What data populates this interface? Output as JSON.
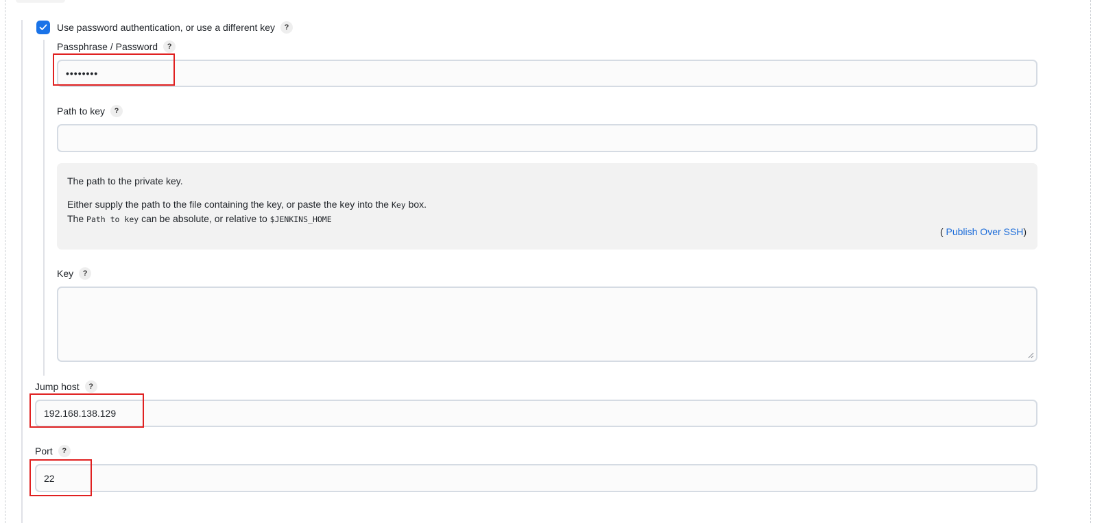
{
  "use_password_auth": {
    "label": "Use password authentication, or use a different key",
    "checked": true,
    "help": "?"
  },
  "passphrase": {
    "label": "Passphrase / Password",
    "help": "?",
    "value": "••••••••"
  },
  "path_to_key": {
    "label": "Path to key",
    "help": "?",
    "value": ""
  },
  "help_text": {
    "line1": "The path to the private key.",
    "line2_part1": "Either supply the path to the file containing the key, or paste the key into the ",
    "line2_code": "Key",
    "line2_part2": " box.",
    "line3_part1": "The ",
    "line3_code1": "Path to key",
    "line3_part2": " can be absolute, or relative to ",
    "line3_code2": "$JENKINS_HOME",
    "plugin_open": "(",
    "plugin_link": " Publish Over SSH",
    "plugin_close": ")"
  },
  "key": {
    "label": "Key",
    "help": "?",
    "value": ""
  },
  "jump_host": {
    "label": "Jump host",
    "help": "?",
    "value": "192.168.138.129"
  },
  "port": {
    "label": "Port",
    "help": "?",
    "value": "22"
  },
  "colors": {
    "checkbox": "#1a73e8",
    "link": "#1a6bd9",
    "highlight": "#e02020",
    "help_box_bg": "#f2f2f2"
  }
}
